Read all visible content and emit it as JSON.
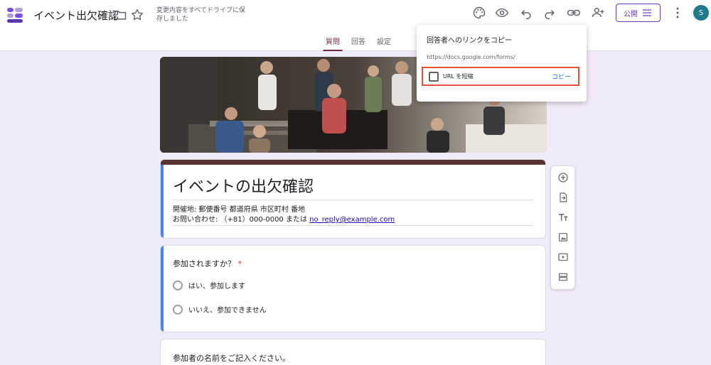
{
  "app": {
    "title": "イベント出欠確認",
    "save_status": "変更内容をすべてドライブに保存しました",
    "publish_label": "公開",
    "avatar_initial": "S"
  },
  "header_icons": [
    "folder-icon",
    "star-icon",
    "palette-icon",
    "preview-icon",
    "undo-icon",
    "redo-icon",
    "link-icon",
    "add-collaborator-icon",
    "tune-icon",
    "more-vert-icon"
  ],
  "tabs": [
    {
      "label": "質問",
      "active": true
    },
    {
      "label": "回答",
      "active": false
    },
    {
      "label": "設定",
      "active": false
    }
  ],
  "form": {
    "title": "イベントの出欠確認",
    "desc_line1": "開催地: 郵便番号 都道府県 市区町村 番地",
    "desc_line2_prefix": "お問い合わせ: （+81）000-0000 または ",
    "desc_email": "no_reply@example.com",
    "question1": {
      "title": "参加されますか？",
      "required_mark": "*",
      "options": [
        "はい、参加します",
        "いいえ、参加できません"
      ]
    },
    "question2": {
      "title": "参加者の名前をご記入ください。"
    }
  },
  "sidebar_tools": [
    "add-question-icon",
    "import-question-icon",
    "add-title-icon",
    "add-image-icon",
    "add-video-icon",
    "add-section-icon"
  ],
  "popup": {
    "title": "回答者へのリンクをコピー",
    "url": "https://docs.google.com/forms/",
    "shorten_label": "URL を短縮",
    "copy_label": "コピー"
  },
  "colors": {
    "accent": "#673ab7",
    "header_strip": "#5a3232",
    "question_highlight": "#4285f4",
    "popup_highlight": "#e8512f",
    "link": "#1a73e8"
  }
}
